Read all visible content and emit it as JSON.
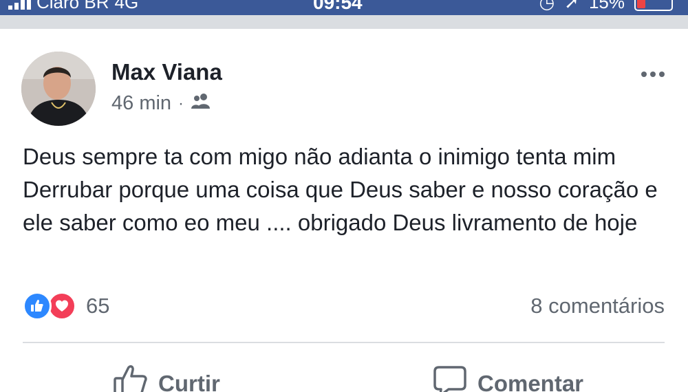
{
  "status_bar": {
    "carrier": "Claro BR",
    "network": "4G",
    "time": "09:54",
    "battery": "15%"
  },
  "post": {
    "author": "Max Viana",
    "time": "46 min",
    "separator": "·",
    "audience_icon": "friends-icon",
    "text": "Deus sempre ta com migo não adianta o inimigo tenta mim Derrubar porque uma coisa que Deus saber e nosso coração e ele saber como eo meu .... obrigado Deus livramento de hoje",
    "reactions": {
      "icons": [
        "like-icon",
        "love-icon"
      ],
      "count": "65"
    },
    "comments": "8 comentários",
    "actions": {
      "like": "Curtir",
      "comment": "Comentar"
    }
  },
  "colors": {
    "status_bar": "#3b5998",
    "like_blue": "#2d88ff",
    "love_red": "#f33e58",
    "secondary_text": "#606770"
  }
}
